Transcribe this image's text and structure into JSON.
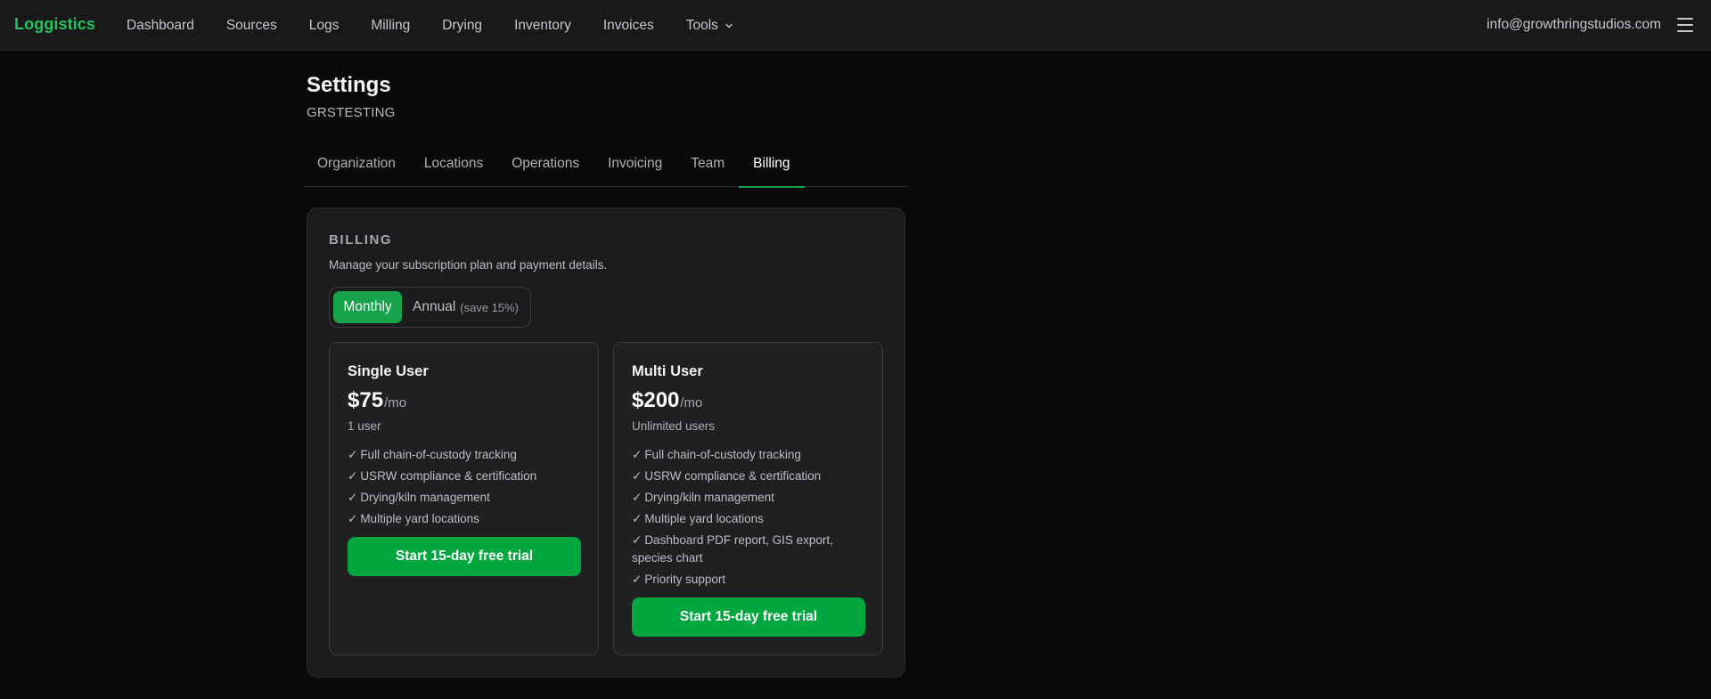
{
  "app": {
    "brand": "Loggistics",
    "brand_color": "#22c55e"
  },
  "nav": {
    "items": [
      {
        "label": "Dashboard"
      },
      {
        "label": "Sources"
      },
      {
        "label": "Logs"
      },
      {
        "label": "Milling"
      },
      {
        "label": "Drying"
      },
      {
        "label": "Inventory"
      },
      {
        "label": "Invoices"
      },
      {
        "label": "Tools",
        "icon": "chevron-down-icon"
      }
    ],
    "user_email": "info@growthringstudios.com",
    "menu_icon": "hamburger-menu-icon"
  },
  "page": {
    "title": "Settings",
    "org_name": "GRSTESTING"
  },
  "tabs": [
    {
      "label": "Organization",
      "active": false
    },
    {
      "label": "Locations",
      "active": false
    },
    {
      "label": "Operations",
      "active": false
    },
    {
      "label": "Invoicing",
      "active": false
    },
    {
      "label": "Team",
      "active": false
    },
    {
      "label": "Billing",
      "active": true
    }
  ],
  "billing": {
    "heading": "BILLING",
    "description": "Manage your subscription plan and payment details.",
    "period_toggle": {
      "monthly_label": "Monthly",
      "annual_label": "Annual",
      "annual_note": "(save 15%)",
      "selected": "Monthly"
    },
    "plans": [
      {
        "name": "Single User",
        "price": "$75",
        "period": "/mo",
        "users": "1 user",
        "features": [
          "Full chain-of-custody tracking",
          "USRW compliance & certification",
          "Drying/kiln management",
          "Multiple yard locations"
        ],
        "cta": "Start 15-day free trial"
      },
      {
        "name": "Multi User",
        "price": "$200",
        "period": "/mo",
        "users": "Unlimited users",
        "features": [
          "Full chain-of-custody tracking",
          "USRW compliance & certification",
          "Drying/kiln management",
          "Multiple yard locations",
          "Dashboard PDF report, GIS export, species chart",
          "Priority support"
        ],
        "cta": "Start 15-day free trial"
      }
    ],
    "check_glyph": "✓",
    "accent_color": "#16a34a"
  }
}
